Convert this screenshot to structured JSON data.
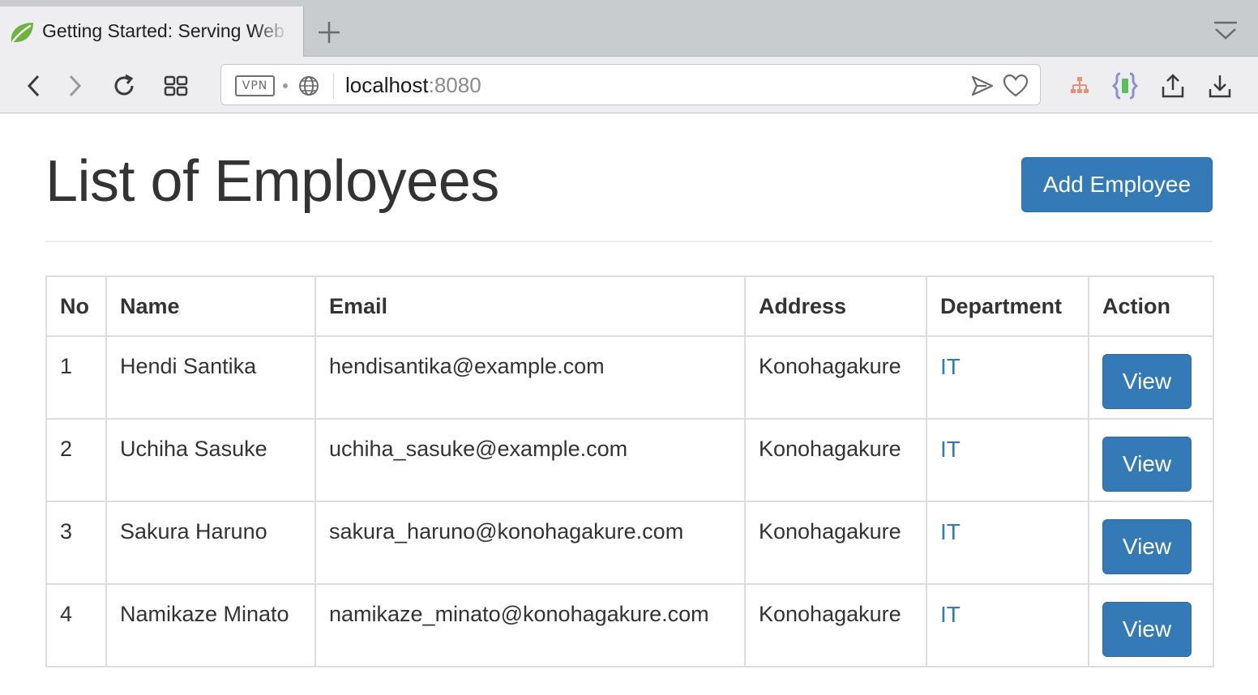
{
  "browser": {
    "tab_title": "Getting Started: Serving Web Content",
    "vpn_label": "VPN",
    "url_host": "localhost",
    "url_port": ":8080",
    "icons": [
      "back-icon",
      "forward-icon",
      "reload-icon",
      "tabs-grid-icon",
      "globe-icon",
      "send-icon",
      "heart-icon",
      "sitemap-icon",
      "bracket-extension-icon",
      "share-icon",
      "download-icon",
      "tab-menu-icon",
      "spring-leaf-icon",
      "plus-icon"
    ]
  },
  "page": {
    "title": "List of Employees",
    "add_button_label": "Add Employee"
  },
  "table": {
    "headers": [
      "No",
      "Name",
      "Email",
      "Address",
      "Department",
      "Action"
    ],
    "rows": [
      {
        "no": "1",
        "name": "Hendi Santika",
        "email": "hendisantika@example.com",
        "address": "Konohagakure",
        "department": "IT",
        "action": "View"
      },
      {
        "no": "2",
        "name": "Uchiha Sasuke",
        "email": "uchiha_sasuke@example.com",
        "address": "Konohagakure",
        "department": "IT",
        "action": "View"
      },
      {
        "no": "3",
        "name": "Sakura Haruno",
        "email": "sakura_haruno@konohagakure.com",
        "address": "Konohagakure",
        "department": "IT",
        "action": "View"
      },
      {
        "no": "4",
        "name": "Namikaze Minato",
        "email": "namikaze_minato@konohagakure.com",
        "address": "Konohagakure",
        "department": "IT",
        "action": "View"
      }
    ]
  },
  "colors": {
    "primary": "#337ab7",
    "link": "#337ab7",
    "border": "#dddddd",
    "text": "#333333"
  }
}
